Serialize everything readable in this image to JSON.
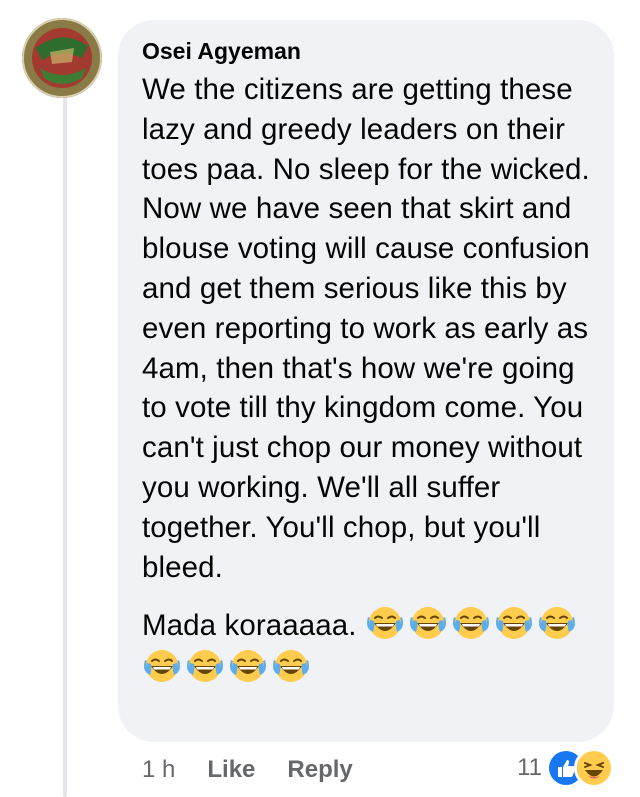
{
  "comment": {
    "author": "Osei Agyeman",
    "paragraphs": [
      "We the citizens are getting these lazy and greedy leaders on their toes paa. No sleep for the wicked. Now we have seen that skirt and blouse voting will cause confusion and get them serious like this by even reporting to work as early as 4am, then that's how we're going to vote till thy kingdom come. You can't just chop our money without you working. We'll all suffer together. You'll chop, but you'll bleed.",
      "Mada koraaaaa."
    ],
    "emoji_count": 9,
    "emoji_name": "face-with-tears-of-joy-icon"
  },
  "actions": {
    "time": "1 h",
    "like_label": "Like",
    "reply_label": "Reply"
  },
  "reactions": {
    "count": "11",
    "icons": [
      "like-reaction-icon",
      "haha-reaction-icon"
    ]
  },
  "colors": {
    "bubble": "#f0f2f5",
    "meta_text": "#65676b",
    "like_blue": "#1877f2",
    "emoji_yellow": "#ffcc4d"
  }
}
